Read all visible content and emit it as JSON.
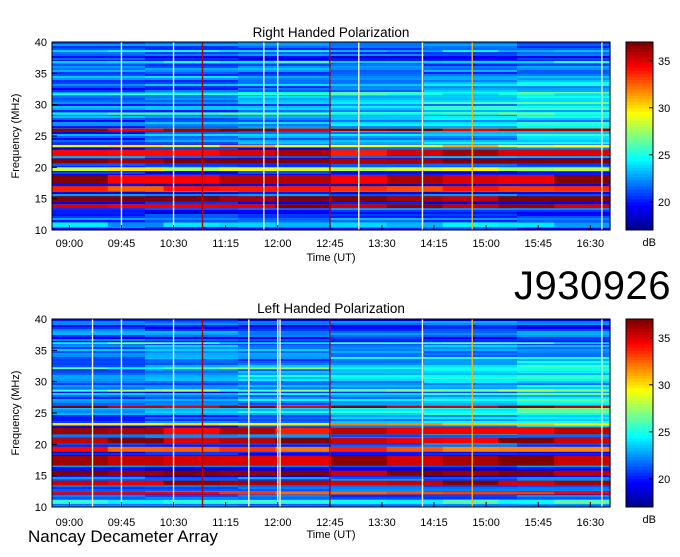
{
  "observation_id": "J930926",
  "instrument": "Nancay Decameter Array",
  "colors": {
    "colormap": [
      "#00008f",
      "#0000ff",
      "#0080ff",
      "#00ffff",
      "#80ff80",
      "#ffff00",
      "#ff8000",
      "#ff0000",
      "#800000"
    ],
    "marker_white": "#f6f6c8",
    "marker_red": "#b00000",
    "marker_orange": "#ffb000"
  },
  "chart_data": [
    {
      "type": "heatmap",
      "title": "Right Handed Polarization",
      "xlabel": "Time (UT)",
      "ylabel": "Frequency (MHz)",
      "x_ticks": [
        "09:00",
        "09:45",
        "10:30",
        "11:15",
        "12:00",
        "12:45",
        "13:30",
        "14:15",
        "15:00",
        "15:45",
        "16:30"
      ],
      "y_ticks": [
        10,
        15,
        20,
        25,
        30,
        35,
        40
      ],
      "ylim": [
        10,
        40
      ],
      "colorbar": {
        "label": "dB",
        "ticks": [
          20,
          25,
          30,
          35
        ],
        "range": [
          17,
          37
        ]
      },
      "bands": [
        {
          "f_low": 10.5,
          "f_high": 11.2,
          "db": 23
        },
        {
          "f_low": 13.5,
          "f_high": 14.1,
          "db": 36
        },
        {
          "f_low": 14.6,
          "f_high": 15.4,
          "db": 37
        },
        {
          "f_low": 16.2,
          "f_high": 17.0,
          "db": 33
        },
        {
          "f_low": 17.4,
          "f_high": 18.8,
          "db": 36
        },
        {
          "f_low": 19.4,
          "f_high": 20.0,
          "db": 29
        },
        {
          "f_low": 20.6,
          "f_high": 21.4,
          "db": 37
        },
        {
          "f_low": 21.8,
          "f_high": 22.8,
          "db": 35
        },
        {
          "f_low": 23.2,
          "f_high": 23.6,
          "db": 30
        },
        {
          "f_low": 25.8,
          "f_high": 26.2,
          "db": 36
        },
        {
          "f_low": 28.4,
          "f_high": 28.7,
          "db": 26
        },
        {
          "f_low": 31.5,
          "f_high": 31.8,
          "db": 25
        },
        {
          "f_low": 36.6,
          "f_high": 37.0,
          "db": 25
        },
        {
          "f_low": 38.4,
          "f_high": 38.7,
          "db": 24
        }
      ],
      "markers": [
        {
          "time": "09:45",
          "color": "white"
        },
        {
          "time": "10:30",
          "color": "white"
        },
        {
          "time": "10:55",
          "color": "red"
        },
        {
          "time": "11:48",
          "color": "white"
        },
        {
          "time": "12:00",
          "color": "white"
        },
        {
          "time": "12:45",
          "color": "red"
        },
        {
          "time": "13:10",
          "color": "white"
        },
        {
          "time": "14:05",
          "color": "white"
        },
        {
          "time": "14:48",
          "color": "orange"
        },
        {
          "time": "16:40",
          "color": "white"
        }
      ]
    },
    {
      "type": "heatmap",
      "title": "Left Handed Polarization",
      "xlabel": "Time (UT)",
      "ylabel": "Frequency (MHz)",
      "x_ticks": [
        "09:00",
        "09:45",
        "10:30",
        "11:15",
        "12:00",
        "12:45",
        "13:30",
        "14:15",
        "15:00",
        "15:45",
        "16:30"
      ],
      "y_ticks": [
        10,
        15,
        20,
        25,
        30,
        35,
        40
      ],
      "ylim": [
        10,
        40
      ],
      "colorbar": {
        "label": "dB",
        "ticks": [
          20,
          25,
          30,
          35
        ],
        "range": [
          17,
          37
        ]
      },
      "bands": [
        {
          "f_low": 10.5,
          "f_high": 11.2,
          "db": 25
        },
        {
          "f_low": 12.0,
          "f_high": 12.4,
          "db": 34
        },
        {
          "f_low": 13.5,
          "f_high": 14.2,
          "db": 36
        },
        {
          "f_low": 15.0,
          "f_high": 15.8,
          "db": 37
        },
        {
          "f_low": 16.6,
          "f_high": 18.2,
          "db": 36
        },
        {
          "f_low": 18.8,
          "f_high": 19.6,
          "db": 33
        },
        {
          "f_low": 20.2,
          "f_high": 21.0,
          "db": 36
        },
        {
          "f_low": 21.6,
          "f_high": 22.6,
          "db": 35
        },
        {
          "f_low": 23.0,
          "f_high": 23.4,
          "db": 31
        },
        {
          "f_low": 25.8,
          "f_high": 26.2,
          "db": 36
        },
        {
          "f_low": 28.4,
          "f_high": 28.7,
          "db": 27
        },
        {
          "f_low": 32.0,
          "f_high": 32.3,
          "db": 26
        },
        {
          "f_low": 36.0,
          "f_high": 36.3,
          "db": 25
        }
      ],
      "markers": [
        {
          "time": "09:20",
          "color": "white"
        },
        {
          "time": "09:45",
          "color": "white"
        },
        {
          "time": "10:30",
          "color": "white"
        },
        {
          "time": "10:55",
          "color": "red"
        },
        {
          "time": "11:35",
          "color": "white"
        },
        {
          "time": "12:00",
          "color": "white"
        },
        {
          "time": "12:02",
          "color": "white"
        },
        {
          "time": "12:45",
          "color": "red"
        },
        {
          "time": "14:05",
          "color": "white"
        },
        {
          "time": "14:48",
          "color": "orange"
        },
        {
          "time": "16:40",
          "color": "white"
        }
      ]
    }
  ]
}
